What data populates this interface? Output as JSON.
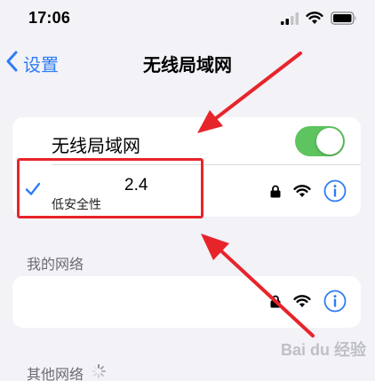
{
  "status_bar": {
    "time": "17:06"
  },
  "nav": {
    "back_label": "设置",
    "title": "无线局域网"
  },
  "wifi_toggle": {
    "label": "无线局域网",
    "enabled": true
  },
  "connected_network": {
    "name": "2.4",
    "security": "低安全性",
    "selected": true
  },
  "sections": {
    "my_networks": "我的网络",
    "other_networks": "其他网络"
  },
  "colors": {
    "accent": "#2f7cf6",
    "toggle_on": "#5dc460",
    "annotation": "#e8242b"
  },
  "icons": [
    "chevron-left-icon",
    "checkmark-icon",
    "lock-icon",
    "wifi-icon",
    "info-icon",
    "cellular-icon",
    "battery-icon",
    "spinner-icon"
  ],
  "watermark": "Bai du 经验"
}
